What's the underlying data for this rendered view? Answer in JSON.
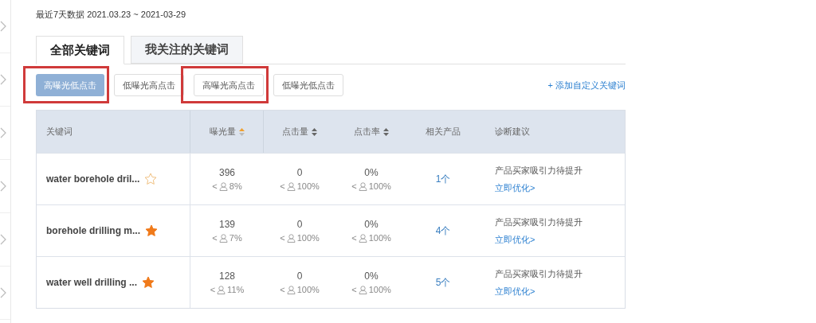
{
  "date_range": "最近7天数据 2021.03.23 ~ 2021-03-29",
  "tabs": [
    {
      "label": "全部关键词",
      "selected": true
    },
    {
      "label": "我关注的关键词",
      "selected": false
    }
  ],
  "filters": [
    {
      "label": "高曝光低点击",
      "selected": true,
      "highlighted": true
    },
    {
      "label": "低曝光高点击",
      "selected": false,
      "highlighted": false
    },
    {
      "label": "高曝光高点击",
      "selected": false,
      "highlighted": true
    },
    {
      "label": "低曝光低点击",
      "selected": false,
      "highlighted": false
    }
  ],
  "add_keyword_link": "+ 添加自定义关键词",
  "table": {
    "columns": [
      {
        "label": "关键词",
        "kind": "plain"
      },
      {
        "label": "曝光量",
        "kind": "sortable",
        "sorted": true
      },
      {
        "label": "点击量",
        "kind": "sortable",
        "sorted": false
      },
      {
        "label": "点击率",
        "kind": "sortable",
        "sorted": false
      },
      {
        "label": "相关产品",
        "kind": "plain"
      },
      {
        "label": "诊断建议",
        "kind": "plain"
      }
    ],
    "rows": [
      {
        "keyword": "water borehole dril...",
        "starred": false,
        "metrics": [
          {
            "value": "396",
            "prefix": "<",
            "rank": "8%"
          },
          {
            "value": "0",
            "prefix": "<",
            "rank": "100%"
          },
          {
            "value": "0%",
            "prefix": "<",
            "rank": "100%"
          }
        ],
        "products": "1个",
        "advice": "产品买家吸引力待提升",
        "action": "立即优化>"
      },
      {
        "keyword": "borehole drilling m...",
        "starred": true,
        "metrics": [
          {
            "value": "139",
            "prefix": "<",
            "rank": "7%"
          },
          {
            "value": "0",
            "prefix": "<",
            "rank": "100%"
          },
          {
            "value": "0%",
            "prefix": "<",
            "rank": "100%"
          }
        ],
        "products": "4个",
        "advice": "产品买家吸引力待提升",
        "action": "立即优化>"
      },
      {
        "keyword": "water well drilling ...",
        "starred": true,
        "metrics": [
          {
            "value": "128",
            "prefix": "<",
            "rank": "11%"
          },
          {
            "value": "0",
            "prefix": "<",
            "rank": "100%"
          },
          {
            "value": "0%",
            "prefix": "<",
            "rank": "100%"
          }
        ],
        "products": "5个",
        "advice": "产品买家吸引力待提升",
        "action": "立即优化>"
      }
    ]
  }
}
